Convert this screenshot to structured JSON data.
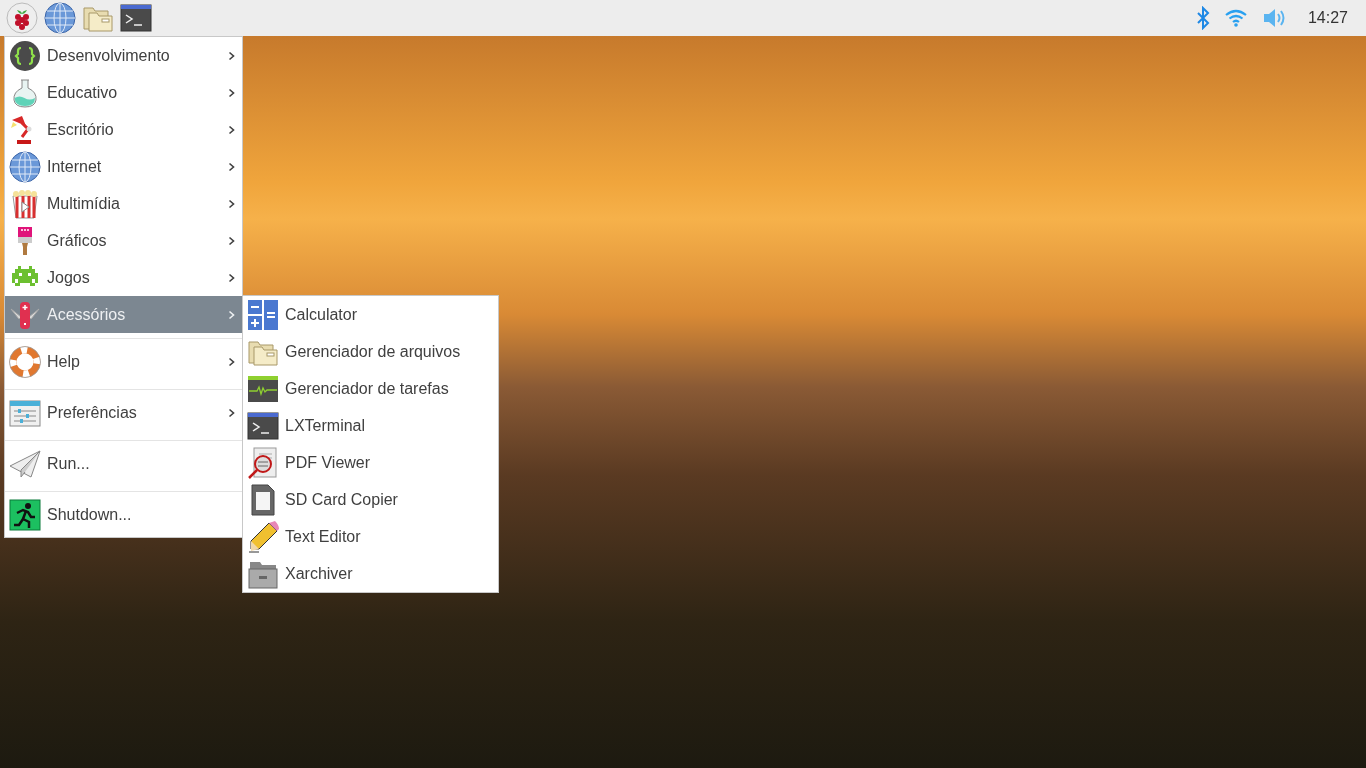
{
  "taskbar": {
    "launchers": [
      {
        "kind": "raspberry"
      },
      {
        "kind": "globe"
      },
      {
        "kind": "folder"
      },
      {
        "kind": "terminal"
      }
    ],
    "clock": "14:27"
  },
  "main_menu": {
    "groups": [
      [
        {
          "label": "Desenvolvimento",
          "submenu": true,
          "selected": false
        },
        {
          "label": "Educativo",
          "submenu": true,
          "selected": false
        },
        {
          "label": "Escritório",
          "submenu": true,
          "selected": false
        },
        {
          "label": "Internet",
          "submenu": true,
          "selected": false
        },
        {
          "label": "Multimídia",
          "submenu": true,
          "selected": false
        },
        {
          "label": "Gráficos",
          "submenu": true,
          "selected": false
        },
        {
          "label": "Jogos",
          "submenu": true,
          "selected": false
        },
        {
          "label": "Acessórios",
          "submenu": true,
          "selected": true
        }
      ],
      [
        {
          "label": "Help",
          "submenu": true,
          "selected": false
        }
      ],
      [
        {
          "label": "Preferências",
          "submenu": true,
          "selected": false
        }
      ],
      [
        {
          "label": "Run...",
          "submenu": false,
          "selected": false
        }
      ],
      [
        {
          "label": "Shutdown...",
          "submenu": false,
          "selected": false
        }
      ]
    ]
  },
  "submenu": {
    "items": [
      {
        "label": "Calculator",
        "selected": false
      },
      {
        "label": "Gerenciador de arquivos",
        "selected": false
      },
      {
        "label": "Gerenciador de tarefas",
        "selected": false
      },
      {
        "label": "LXTerminal",
        "selected": false
      },
      {
        "label": "PDF Viewer",
        "selected": false
      },
      {
        "label": "SD Card Copier",
        "selected": false
      },
      {
        "label": "Text Editor",
        "selected": false
      },
      {
        "label": "Xarchiver",
        "selected": false
      }
    ]
  }
}
